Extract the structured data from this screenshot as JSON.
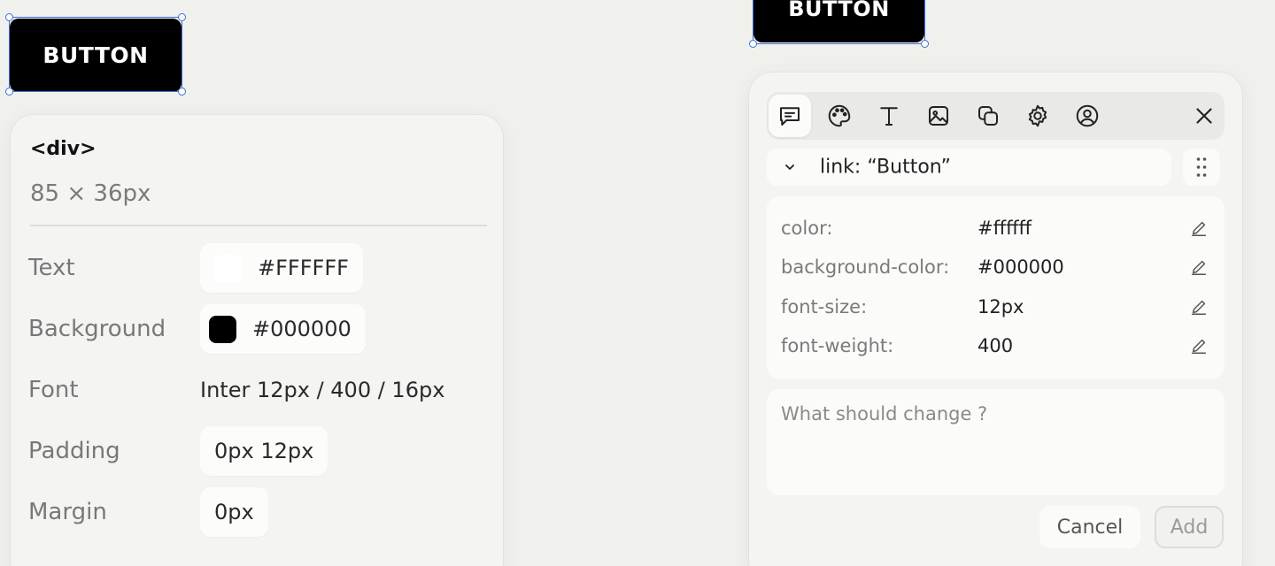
{
  "canvas": {
    "left_button_label": "BUTTON",
    "right_button_label": "BUTTON"
  },
  "inspector": {
    "tag": "<div>",
    "dimensions": "85 × 36px",
    "rows": {
      "text": {
        "label": "Text",
        "value": "#FFFFFF",
        "swatch": "#ffffff"
      },
      "background": {
        "label": "Background",
        "value": "#000000",
        "swatch": "#000000"
      },
      "font": {
        "label": "Font",
        "value": "Inter 12px / 400 / 16px"
      },
      "padding": {
        "label": "Padding",
        "value": "0px 12px"
      },
      "margin": {
        "label": "Margin",
        "value": "0px"
      }
    }
  },
  "panel": {
    "toolbar": [
      "comment-icon",
      "palette-icon",
      "text-icon",
      "image-icon",
      "layers-icon",
      "settings-icon",
      "user-icon",
      "close-icon"
    ],
    "selector": "link: “Button”",
    "properties": [
      {
        "key": "color:",
        "value": "#ffffff"
      },
      {
        "key": "background-color:",
        "value": "#000000"
      },
      {
        "key": "font-size:",
        "value": "12px"
      },
      {
        "key": "font-weight:",
        "value": "400"
      }
    ],
    "comment_placeholder": "What should change ?",
    "cancel_label": "Cancel",
    "add_label": "Add"
  }
}
